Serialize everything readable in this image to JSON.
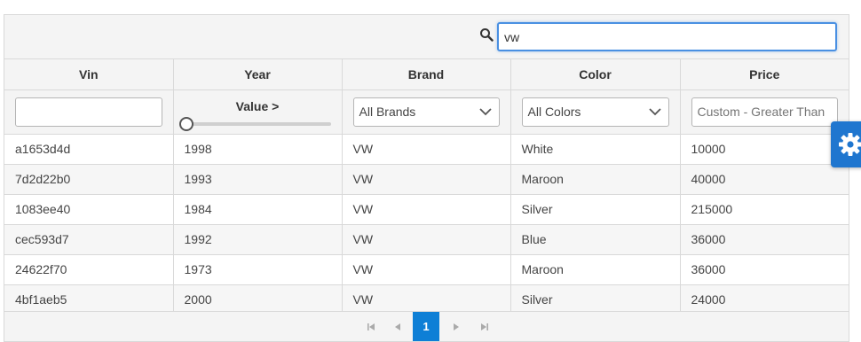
{
  "search": {
    "value": "vw"
  },
  "columns": [
    "Vin",
    "Year",
    "Brand",
    "Color",
    "Price"
  ],
  "filters": {
    "year_label": "Value >",
    "year_slider_level": 0,
    "brand_selected": "All Brands",
    "color_selected": "All Colors",
    "price_placeholder": "Custom - Greater Than"
  },
  "rows": [
    [
      "a1653d4d",
      "1998",
      "VW",
      "White",
      "10000"
    ],
    [
      "7d2d22b0",
      "1993",
      "VW",
      "Maroon",
      "40000"
    ],
    [
      "1083ee40",
      "1984",
      "VW",
      "Silver",
      "215000"
    ],
    [
      "cec593d7",
      "1992",
      "VW",
      "Blue",
      "36000"
    ],
    [
      "24622f70",
      "1973",
      "VW",
      "Maroon",
      "36000"
    ],
    [
      "4bf1aeb5",
      "2000",
      "VW",
      "Silver",
      "24000"
    ]
  ],
  "pager": {
    "current_page": "1"
  },
  "icons": {
    "search": "search-icon",
    "settings": "gear-icon",
    "first": "first-page-icon",
    "prev": "prev-page-icon",
    "next": "next-page-icon",
    "last": "last-page-icon"
  },
  "colors": {
    "accent": "#0e7fd6",
    "settings_button": "#1f76cf",
    "focus_border": "#4a90e2"
  }
}
